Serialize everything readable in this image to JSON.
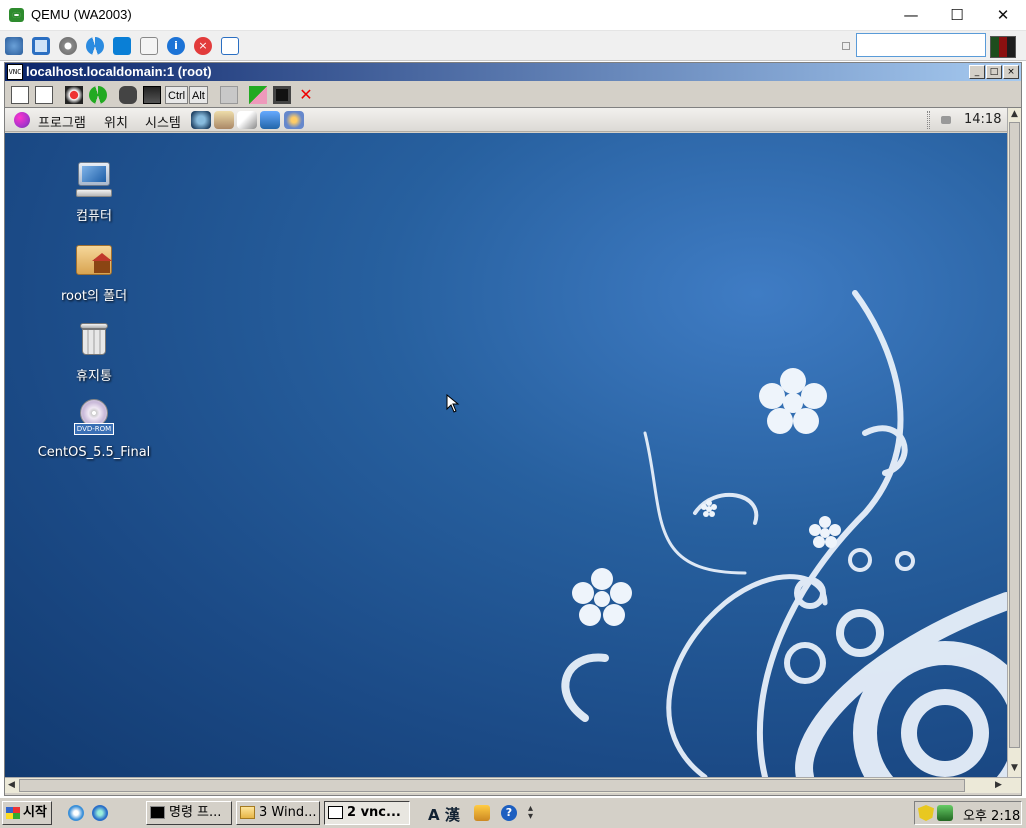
{
  "qemu": {
    "title": "QEMU (WA2003)",
    "minimize": "—",
    "maximize": "☐",
    "close": "✕",
    "toolbar_input_value": ""
  },
  "vnc": {
    "title": "localhost.localdomain:1 (root)",
    "ctrl_key": "Ctrl",
    "alt_key": "Alt"
  },
  "gnome_panel": {
    "menus": [
      "프로그램",
      "위치",
      "시스템"
    ],
    "clock": "14:18"
  },
  "desktop": {
    "icons": [
      {
        "label": "컴퓨터",
        "icon": "computer-icon"
      },
      {
        "label": "root의 폴더",
        "icon": "home-folder-icon"
      },
      {
        "label": "휴지통",
        "icon": "trash-icon"
      },
      {
        "label": "CentOS_5.5_Final",
        "icon": "dvd-rom-icon",
        "badge": "DVD-ROM"
      }
    ]
  },
  "taskbar": {
    "start_label": "시작",
    "tasks": [
      {
        "label": "명령 프...",
        "active": false
      },
      {
        "label": "3 Wind...",
        "active": false
      },
      {
        "label": "2 vnc...",
        "active": true
      }
    ],
    "ime_label": "A 漢",
    "time": "오후 2:18"
  },
  "colors": {
    "desktop_bg": "#1b4a86",
    "vnc_title": "#0a246a",
    "accent": "#5a9bd8"
  }
}
